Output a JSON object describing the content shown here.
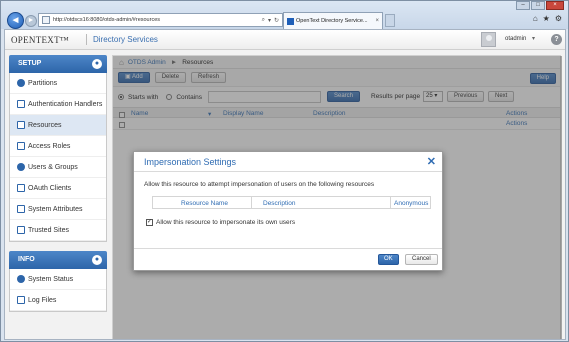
{
  "browser": {
    "address": "http://otdscs16:8080/otds-admin/#resources",
    "tab_title": "OpenText Directory Service...",
    "tab_close": "×",
    "window_buttons": [
      "–",
      "□",
      "×"
    ],
    "chrome_icons": [
      "home-icon",
      "star-icon",
      "gear-icon"
    ]
  },
  "header": {
    "brand": "OPENTEXT™",
    "product": "Directory Services",
    "user": "otadmin",
    "help": "?"
  },
  "sidebar": {
    "setup_title": "SETUP",
    "setup_items": [
      {
        "label": "Partitions"
      },
      {
        "label": "Authentication Handlers"
      },
      {
        "label": "Resources"
      },
      {
        "label": "Access Roles"
      },
      {
        "label": "Users & Groups"
      },
      {
        "label": "OAuth Clients"
      },
      {
        "label": "System Attributes"
      },
      {
        "label": "Trusted Sites"
      }
    ],
    "info_title": "INFO",
    "info_items": [
      {
        "label": "System Status"
      },
      {
        "label": "Log Files"
      }
    ]
  },
  "breadcrumb": {
    "root": "OTDS Admin",
    "current": "Resources"
  },
  "toolbar": {
    "add": "Add",
    "delete": "Delete",
    "refresh": "Refresh",
    "help": "Help"
  },
  "search": {
    "starts_with": "Starts with",
    "contains": "Contains",
    "search_button": "Search",
    "rpp_label": "Results per page",
    "rpp_value": "25",
    "previous": "Previous",
    "next": "Next"
  },
  "table": {
    "headers": [
      "Name",
      "Display Name",
      "Description",
      "Actions"
    ],
    "row_action": "Actions"
  },
  "modal": {
    "title": "Impersonation Settings",
    "close": "✕",
    "description": "Allow this resource to attempt impersonation of users on the following resources",
    "columns": [
      "Resource Name",
      "Description",
      "Anonymous"
    ],
    "checkbox_label": "Allow this resource to impersonate its own users",
    "checkbox_checked": true,
    "ok": "OK",
    "cancel": "Cancel"
  }
}
